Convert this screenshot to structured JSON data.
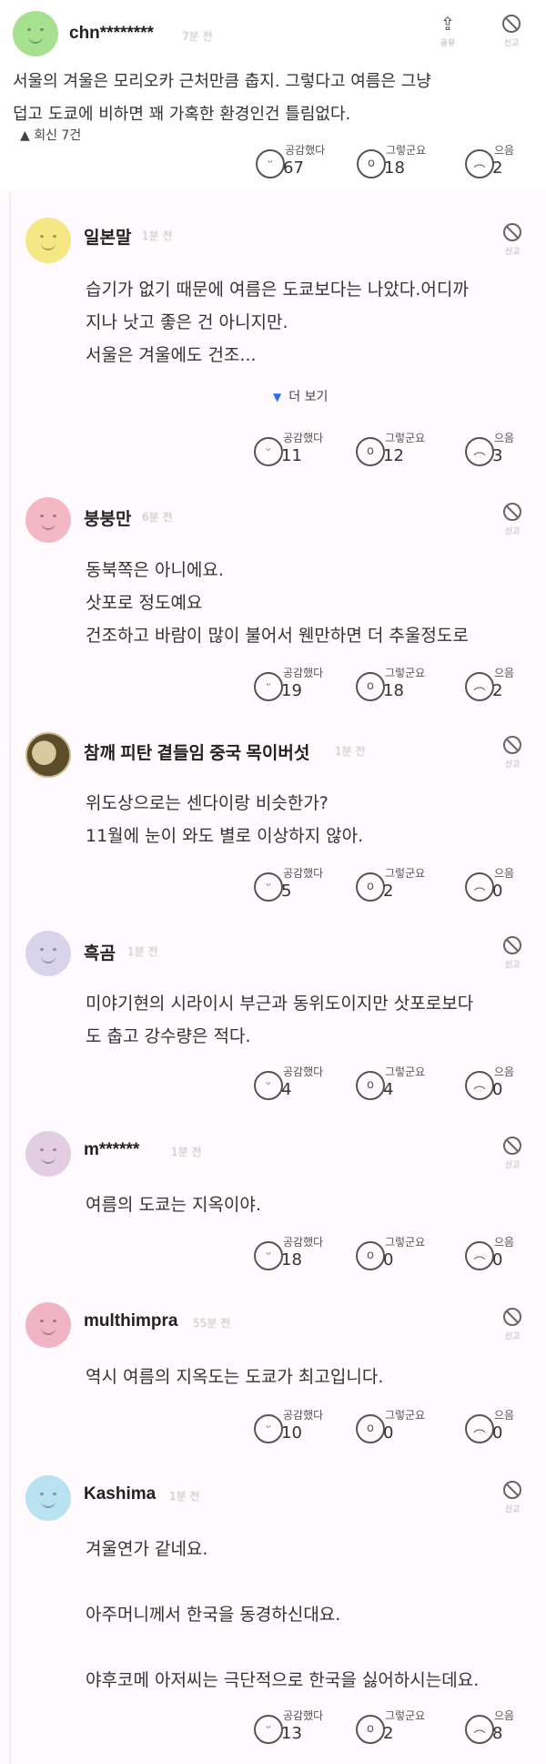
{
  "top": {
    "name": "chn********",
    "time": "7분 전",
    "share_label": "공유",
    "report_label": "신고",
    "text": "서울의 겨울은 모리오카 근처만큼 춥지. 그렇다고 여름은 그냥\n덥고 도쿄에 비하면 꽤 가혹한 환경인건 틀림없다.",
    "replies_label": "▲ 회신 7건",
    "reactions": [
      {
        "label": "공감했다",
        "count": "67",
        "icon": "smile-face-icon"
      },
      {
        "label": "그렇군요",
        "count": "18",
        "icon": "surprised-face-icon"
      },
      {
        "label": "으음",
        "count": "2",
        "icon": "frown-face-icon"
      }
    ],
    "avatar_color": "#a7e08e"
  },
  "replies": [
    {
      "name": "일본말",
      "time": "1분 전",
      "report_label": "신고",
      "text": "습기가 없기 때문에 여름은 도쿄보다는 나았다.어디까\n지나 낫고 좋은 건 아니지만.\n서울은 겨울에도 건조...",
      "more_label": "더 보기",
      "avatar_color": "#f5e783",
      "reactions": [
        {
          "label": "공감했다",
          "count": "11"
        },
        {
          "label": "그렇군요",
          "count": "12"
        },
        {
          "label": "으음",
          "count": "3"
        }
      ]
    },
    {
      "name": "붕붕만",
      "time": "6분 전",
      "report_label": "신고",
      "text": "동북쪽은 아니에요.\n삿포로 정도예요\n건조하고 바람이 많이 불어서 웬만하면 더 추울정도로",
      "avatar_color": "#f4b8c4",
      "reactions": [
        {
          "label": "공감했다",
          "count": "19"
        },
        {
          "label": "그렇군요",
          "count": "18"
        },
        {
          "label": "으음",
          "count": "2"
        }
      ]
    },
    {
      "name": "참깨 피탄 곁들임 중국 목이버섯",
      "time": "1분 전",
      "report_label": "신고",
      "text": "위도상으로는 센다이랑 비슷한가?\n11월에 눈이 와도 별로 이상하지 않아.",
      "avatar_color": "#7a6a3a",
      "reactions": [
        {
          "label": "공감했다",
          "count": "5"
        },
        {
          "label": "그렇군요",
          "count": "2"
        },
        {
          "label": "으음",
          "count": "0"
        }
      ]
    },
    {
      "name": "흑곰",
      "time": "1분 전",
      "report_label": "신고",
      "text": "미야기현의 시라이시 부근과 동위도이지만 삿포로보다\n도 춥고 강수량은 적다.",
      "avatar_color": "#d8d4ec",
      "reactions": [
        {
          "label": "공감했다",
          "count": "4"
        },
        {
          "label": "그렇군요",
          "count": "4"
        },
        {
          "label": "으음",
          "count": "0"
        }
      ]
    },
    {
      "name": "m******",
      "time": "1분 전",
      "report_label": "신고",
      "text": "여름의 도쿄는 지옥이야.",
      "avatar_color": "#e2cde2",
      "reactions": [
        {
          "label": "공감했다",
          "count": "18"
        },
        {
          "label": "그렇군요",
          "count": "0"
        },
        {
          "label": "으음",
          "count": "0"
        }
      ]
    },
    {
      "name": "multhimpra",
      "time": "55분 전",
      "report_label": "신고",
      "text": "역시 여름의 지옥도는 도쿄가 최고입니다.",
      "avatar_color": "#f0b4c4",
      "reactions": [
        {
          "label": "공감했다",
          "count": "10"
        },
        {
          "label": "그렇군요",
          "count": "0"
        },
        {
          "label": "으음",
          "count": "0"
        }
      ]
    },
    {
      "name": "Kashima",
      "time": "1분 전",
      "report_label": "신고",
      "text": "겨울연가 같네요.\n\n아주머니께서 한국을 동경하신대요.\n\n야후코메 아저씨는 극단적으로 한국을 싫어하시는데요.",
      "avatar_color": "#b8e2f2",
      "reactions": [
        {
          "label": "공감했다",
          "count": "13"
        },
        {
          "label": "그렇군요",
          "count": "2"
        },
        {
          "label": "으음",
          "count": "8"
        }
      ]
    }
  ]
}
